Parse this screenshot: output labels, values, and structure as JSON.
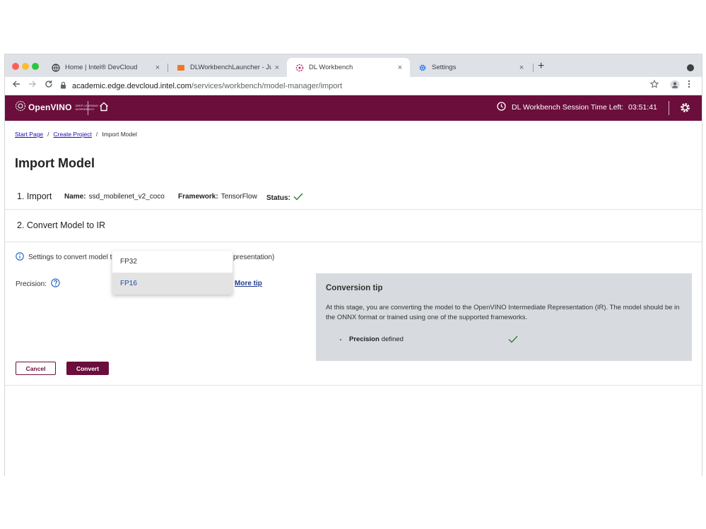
{
  "browser": {
    "tabs": [
      {
        "label": "Home | Intel® DevCloud",
        "icon": "globe-icon"
      },
      {
        "label": "DLWorkbenchLauncher - Jupyt",
        "icon": "jupyter-icon"
      },
      {
        "label": "DL Workbench",
        "icon": "workbench-icon"
      },
      {
        "label": "Settings",
        "icon": "settings-gear-icon"
      }
    ],
    "tab_close": "×",
    "new_tab": "+",
    "url_host": "academic.edge.devcloud.intel.com",
    "url_path": "/services/workbench/model-manager/import"
  },
  "app": {
    "logo_text": "OpenVINO",
    "logo_sub_1": "DEEP LEARNING",
    "logo_sub_2": "WORKBENCH",
    "session_label": "DL Workbench Session Time Left:",
    "session_time": "03:51:41",
    "accent_color": "#6b0e3c"
  },
  "breadcrumb": {
    "start": "Start Page",
    "create": "Create Project",
    "current": "Import Model",
    "sep": "/"
  },
  "page": {
    "title": "Import Model",
    "step1": {
      "title": "1. Import",
      "name_label": "Name:",
      "name_value": "ssd_mobilenet_v2_coco",
      "framework_label": "Framework:",
      "framework_value": "TensorFlow",
      "status_label": "Status:"
    },
    "step2": {
      "title": "2. Convert Model to IR"
    },
    "info_text": "Settings to convert model t",
    "info_tail": "presentation)",
    "precision_label": "Precision:",
    "more_tip": "More tip",
    "dropdown": {
      "options": [
        "FP32",
        "FP16"
      ],
      "selected": "FP16"
    },
    "tip": {
      "title": "Conversion tip",
      "body": "At this stage, you are converting the model to the OpenVINO Intermediate Representation (IR). The model should be in the ONNX format or trained using one of the supported frameworks.",
      "item_bold": "Precision",
      "item_rest": "defined"
    },
    "cancel_label": "Cancel",
    "convert_label": "Convert"
  }
}
